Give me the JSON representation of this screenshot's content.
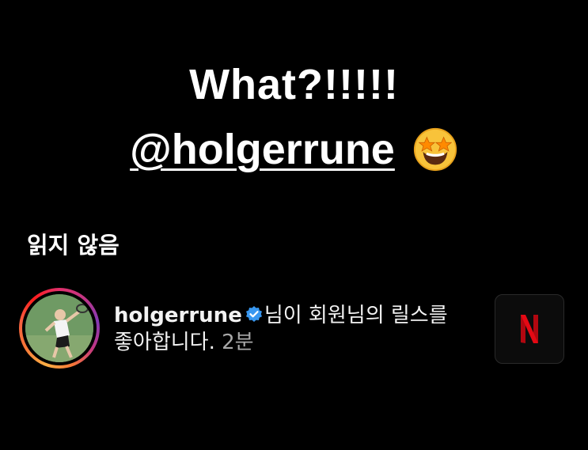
{
  "story": {
    "line1": "What?!!!!!",
    "mention": "@holgerrune",
    "emoji": "star-struck-emoji"
  },
  "section": {
    "header": "읽지 않음"
  },
  "notification": {
    "username": "holgerrune",
    "verified": true,
    "message": "님이 회원님의 릴스를 좋아합니다.",
    "time": "2분",
    "thumbnail_icon": "netflix-logo-icon"
  },
  "colors": {
    "background": "#000000",
    "text": "#ffffff",
    "verified_badge": "#3897f0",
    "netflix_red": "#e50914",
    "time_text": "#a8a8a8"
  }
}
